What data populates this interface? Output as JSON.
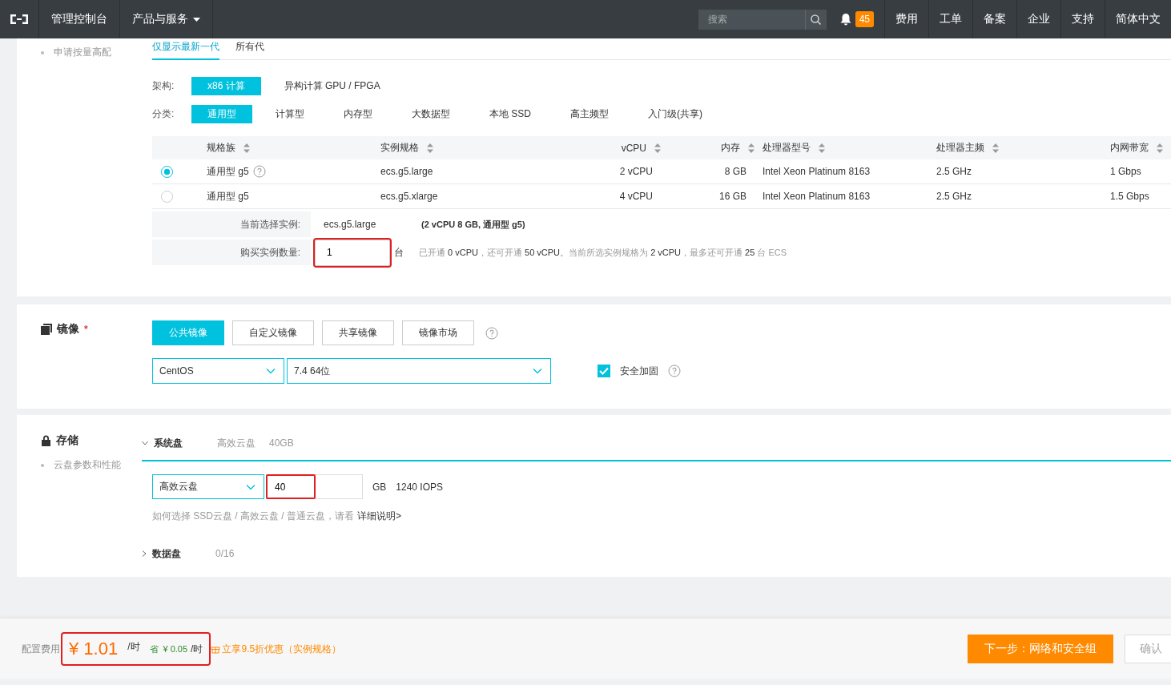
{
  "header": {
    "console": "管理控制台",
    "products": "产品与服务",
    "search": {
      "placeholder": "搜索"
    },
    "badge": "45",
    "links": [
      "费用",
      "工单",
      "备案",
      "企业",
      "支持",
      "简体中文"
    ]
  },
  "instance": {
    "side_items": [
      "申请按量高配"
    ],
    "generation_tabs": [
      {
        "label": "仅显示最新一代",
        "selected": true
      },
      {
        "label": "所有代",
        "selected": false
      }
    ],
    "arch_label": "架构:",
    "arch": [
      {
        "label": "x86 计算",
        "selected": true
      },
      {
        "label": "异构计算 GPU / FPGA",
        "selected": false
      }
    ],
    "category_label": "分类:",
    "categories": [
      {
        "label": "通用型",
        "selected": true
      },
      {
        "label": "计算型",
        "selected": false
      },
      {
        "label": "内存型",
        "selected": false
      },
      {
        "label": "大数据型",
        "selected": false
      },
      {
        "label": "本地 SSD",
        "selected": false
      },
      {
        "label": "高主频型",
        "selected": false
      },
      {
        "label": "入门级(共享)",
        "selected": false
      }
    ],
    "table": {
      "columns": [
        "规格族",
        "实例规格",
        "vCPU",
        "内存",
        "处理器型号",
        "处理器主频",
        "内网带宽"
      ],
      "rows": [
        {
          "selected": true,
          "help": true,
          "cells": [
            "通用型 g5",
            "ecs.g5.large",
            "2 vCPU",
            "8 GB",
            "Intel Xeon Platinum 8163",
            "2.5 GHz",
            "1 Gbps"
          ]
        },
        {
          "selected": false,
          "help": false,
          "cells": [
            "通用型 g5",
            "ecs.g5.xlarge",
            "4 vCPU",
            "16 GB",
            "Intel Xeon Platinum 8163",
            "2.5 GHz",
            "1.5 Gbps"
          ]
        }
      ]
    },
    "current_label": "当前选择实例:",
    "current_value": "ecs.g5.large",
    "current_desc": "(2 vCPU 8 GB, 通用型 g5)",
    "quantity_label": "购买实例数量:",
    "quantity": {
      "value": "1",
      "highlighted": true
    },
    "quantity_unit": "台",
    "quota_note": "已开通 **0 vCPU**，还可开通 **50 vCPU**。当前所选实例规格为 **2 vCPU**，最多还可开通 **25** 台 ECS"
  },
  "image": {
    "title": "镜像",
    "required": "*",
    "tabs": [
      {
        "label": "公共镜像",
        "selected": true
      },
      {
        "label": "自定义镜像",
        "selected": false
      },
      {
        "label": "共享镜像",
        "selected": false
      },
      {
        "label": "镜像市场",
        "selected": false
      }
    ],
    "os": "CentOS",
    "version": "7.4 64位",
    "hardening": {
      "label": "安全加固",
      "checked": true
    }
  },
  "storage": {
    "title": "存储",
    "side_items": [
      "云盘参数和性能"
    ],
    "system_disk": {
      "label": "系统盘",
      "expanded": true,
      "type": "高效云盘",
      "size": "40GB"
    },
    "disk_type": "高效云盘",
    "disk_size": {
      "value": "40",
      "highlighted": true
    },
    "unit": "GB",
    "iops": "1240 IOPS",
    "hint": "如何选择 SSD云盘 / 高效云盘 / 普通云盘，请看",
    "hint_link": "详细说明>",
    "data_disk": {
      "label": "数据盘",
      "expanded": false,
      "count": "0/16"
    }
  },
  "footer": {
    "label": "配置费用",
    "price": {
      "amount": "¥ 1.01",
      "per": "/时",
      "save_label": "省",
      "save": "¥ 0.05",
      "save_per": "/时",
      "highlighted": true
    },
    "promo": "立享9.5折优惠（实例规格）",
    "buttons": [
      {
        "label": "下一步：网络和安全组",
        "kind": "primary"
      },
      {
        "label": "确认",
        "kind": "secondary"
      }
    ]
  }
}
